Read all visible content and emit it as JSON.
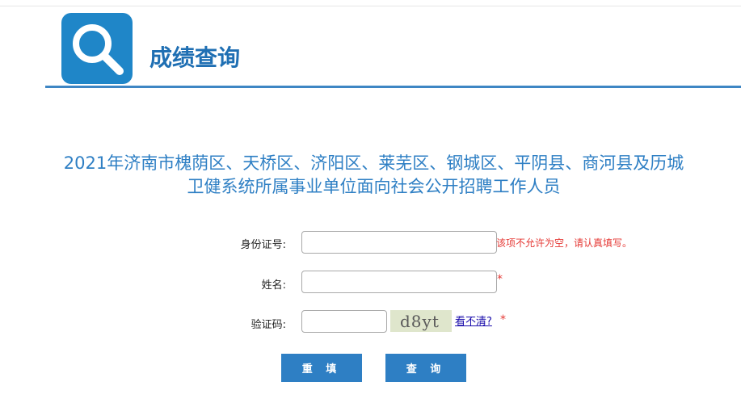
{
  "header": {
    "title": "成绩查询"
  },
  "headline": {
    "line1": "2021年济南市槐荫区、天桥区、济阳区、莱芜区、钢城区、平阴县、商河县及历城",
    "line2": "卫健系统所属事业单位面向社会公开招聘工作人员"
  },
  "form": {
    "id_label": "身份证号:",
    "id_value": "",
    "id_error": "该项不允许为空，请认真填写。",
    "name_label": "姓名:",
    "name_value": "",
    "name_required": "*",
    "captcha_label": "验证码:",
    "captcha_value": "",
    "captcha_text": "d8yt",
    "refresh_link": "看不清?",
    "captcha_required": "*"
  },
  "buttons": {
    "reset": "重 填",
    "query": "查 询"
  },
  "colors": {
    "accent": "#2e7fc4",
    "error": "#e53935"
  },
  "icons": {
    "logo": "search-icon"
  }
}
